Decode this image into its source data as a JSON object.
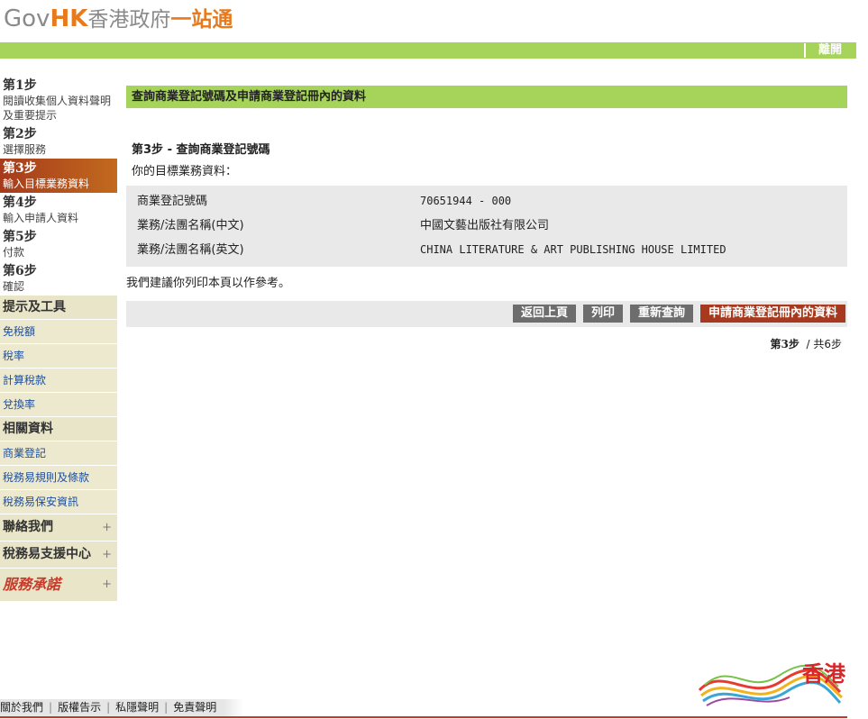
{
  "header": {
    "logo_gov": "Gov",
    "logo_hk": "HK",
    "logo_zh1": "香港政府",
    "logo_zh2": "一站通",
    "logout": "離開"
  },
  "sidebar": {
    "steps": [
      {
        "title": "第1步",
        "desc": "閱讀收集個人資料聲明及重要提示"
      },
      {
        "title": "第2步",
        "desc": "選擇服務"
      },
      {
        "title": "第3步",
        "desc": "輸入目標業務資料"
      },
      {
        "title": "第4步",
        "desc": "輸入申請人資料"
      },
      {
        "title": "第5步",
        "desc": "付款"
      },
      {
        "title": "第6步",
        "desc": "確認"
      }
    ],
    "tips_title": "提示及工具",
    "tips_links": [
      "免稅額",
      "稅率",
      "計算稅款",
      "兌換率"
    ],
    "related_title": "相關資料",
    "related_links": [
      "商業登記",
      "稅務易規則及條款",
      "稅務易保安資訊"
    ],
    "contact": "聯絡我們",
    "support": "稅務易支援中心",
    "promise": "服務承諾"
  },
  "main": {
    "page_title": "查詢商業登記號碼及申請商業登記冊內的資料",
    "step_title": "第3步 - 查詢商業登記號碼",
    "subtitle": "你的目標業務資料：",
    "rows": [
      {
        "label": "商業登記號碼",
        "value": "70651944 - 000"
      },
      {
        "label": "業務/法團名稱(中文)",
        "value": "中國文藝出版社有限公司"
      },
      {
        "label": "業務/法團名稱(英文)",
        "value": "CHINA LITERATURE & ART PUBLISHING HOUSE LIMITED"
      }
    ],
    "note": "我們建議你列印本頁以作參考。",
    "buttons": {
      "back": "返回上頁",
      "print": "列印",
      "requery": "重新查詢",
      "apply": "申請商業登記冊內的資料"
    },
    "step_count_bold": "第3步",
    "step_count_rest": "/ 共6步"
  },
  "footer": {
    "links": [
      "關於我們",
      "版權告示",
      "私隱聲明",
      "免責聲明"
    ]
  },
  "brand": {
    "text": "香港"
  },
  "colors": {
    "accent_green": "#a6d35a",
    "primary_red": "#a6391e",
    "orange": "#e97a1b"
  }
}
